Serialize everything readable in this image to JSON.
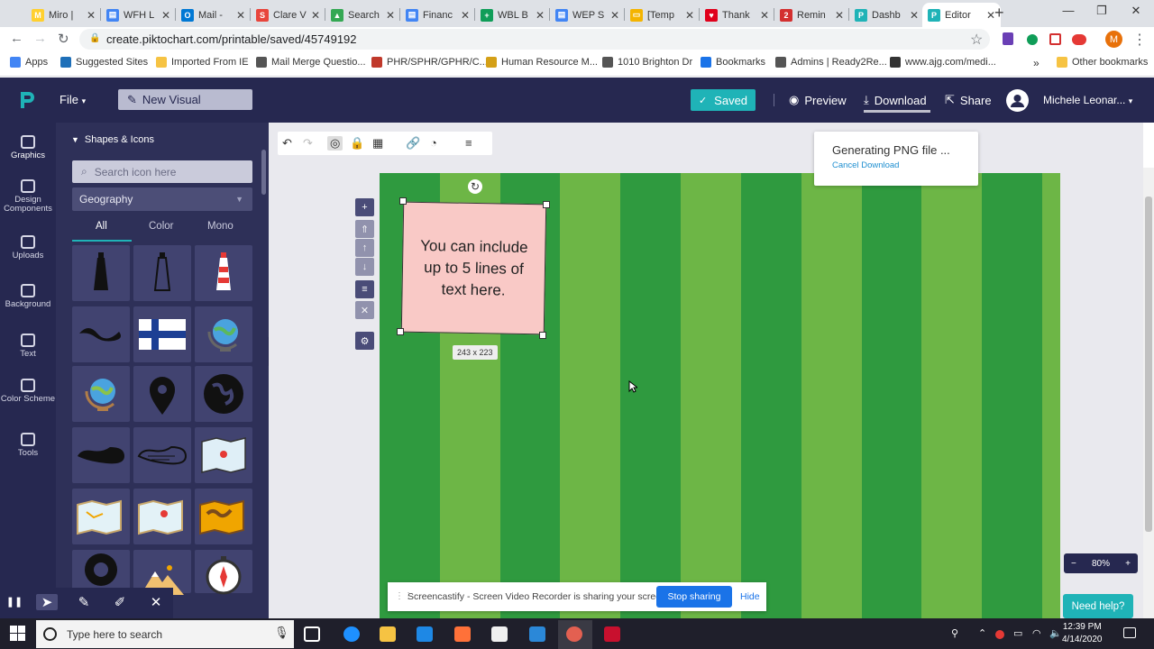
{
  "browser": {
    "tabs": [
      {
        "label": "Miro |",
        "color": "#ffd02f",
        "glyph": "M"
      },
      {
        "label": "WFH L",
        "color": "#4285f4",
        "glyph": "▤"
      },
      {
        "label": "Mail -",
        "color": "#0078d4",
        "glyph": "O"
      },
      {
        "label": "Clare V",
        "color": "#e8453c",
        "glyph": "S"
      },
      {
        "label": "Search",
        "color": "#34a853",
        "glyph": "▲"
      },
      {
        "label": "Financ",
        "color": "#4285f4",
        "glyph": "▤"
      },
      {
        "label": "WBL B",
        "color": "#0f9d58",
        "glyph": "+"
      },
      {
        "label": "WEP S",
        "color": "#4285f4",
        "glyph": "▤"
      },
      {
        "label": "[Temp",
        "color": "#f4b400",
        "glyph": "▭"
      },
      {
        "label": "Thank",
        "color": "#e0001b",
        "glyph": "♥"
      },
      {
        "label": "Remin",
        "color": "#d32f2f",
        "glyph": "2"
      },
      {
        "label": "Dashb",
        "color": "#1fb3b7",
        "glyph": "P"
      },
      {
        "label": "Editor",
        "color": "#1fb3b7",
        "glyph": "P"
      }
    ],
    "active_tab": "Editor",
    "new_tab_icon": "+",
    "window_controls": [
      "—",
      "❐",
      "✕"
    ],
    "url": "create.piktochart.com/printable/saved/45749192",
    "nav": {
      "back": "←",
      "forward": "→",
      "reload": "↻",
      "lock": "🔒",
      "star": "☆",
      "menu": "⋮",
      "profile": "M"
    },
    "bookmarks": [
      {
        "label": "Apps",
        "color": "#4285f4"
      },
      {
        "label": "Suggested Sites",
        "color": "#1e6fb8"
      },
      {
        "label": "Imported From IE",
        "color": "#f6c343"
      },
      {
        "label": "Mail Merge Questio...",
        "color": "#555"
      },
      {
        "label": "PHR/SPHR/GPHR/C...",
        "color": "#c0392b"
      },
      {
        "label": "Human Resource M...",
        "color": "#d4a017"
      },
      {
        "label": "1010 Brighton Dr",
        "color": "#555"
      },
      {
        "label": "Bookmarks",
        "color": "#1a73e8"
      },
      {
        "label": "Admins | Ready2Re...",
        "color": "#555"
      },
      {
        "label": "www.ajg.com/medi...",
        "color": "#333"
      }
    ],
    "more_bookmarks": "»",
    "other_bookmarks": "Other bookmarks"
  },
  "app": {
    "file_menu": "File",
    "new_visual": "New Visual",
    "saved": "Saved",
    "preview": "Preview",
    "download": "Download",
    "share": "Share",
    "user_name": "Michele Leonar...",
    "brand_color": "#1fb3b7",
    "header_color": "#262850"
  },
  "rail": [
    {
      "label": "Graphics",
      "active": true
    },
    {
      "label": "Design Components"
    },
    {
      "label": "Uploads"
    },
    {
      "label": "Background"
    },
    {
      "label": "Text"
    },
    {
      "label": "Color Scheme"
    },
    {
      "label": "Tools"
    }
  ],
  "panel": {
    "title": "Shapes & Icons",
    "search_placeholder": "Search icon here",
    "category": "Geography",
    "filters": [
      "All",
      "Color",
      "Mono"
    ],
    "active_filter": "All",
    "icons": [
      "lighthouse-icon",
      "lighthouse-outline-icon",
      "lighthouse-color-icon",
      "islands-icon",
      "finland-flag-icon",
      "globe-stand-icon",
      "globe-color-icon",
      "location-pin-icon",
      "earth-icon",
      "lake-black-icon",
      "lake-outline-icon",
      "map-color-icon",
      "map-fold-icon",
      "map-pin-icon",
      "treasure-map-icon",
      "lifebuoy-icon",
      "mountain-icon",
      "compass-icon"
    ]
  },
  "editor": {
    "toolbar": [
      "undo",
      "redo",
      "mask",
      "lock",
      "transparency",
      "link",
      "fill",
      "align"
    ],
    "toolbar_glyphs": [
      "↶",
      "↷",
      "◎",
      "🔒",
      "▦",
      "🔗",
      "◔",
      "≡"
    ],
    "vertical_tools": [
      "+",
      "⇑",
      "↑",
      "↓",
      "≡",
      "✕",
      "⚙"
    ],
    "note_text": "You can include up to 5 lines of text here.",
    "size_label": "243 x 223",
    "canvas_stripe_dark": "#2f9a3f",
    "canvas_stripe_light": "#6db646",
    "toast_title": "Generating PNG file ...",
    "toast_link": "Cancel Download",
    "zoom": "80%",
    "zoom_minus": "−",
    "zoom_plus": "+",
    "help": "Need help?"
  },
  "screencastify": {
    "message": "Screencastify - Screen Video Recorder is sharing your screen.",
    "stop": "Stop sharing",
    "hide": "Hide",
    "tools": [
      "❚❚",
      "➤",
      "✎",
      "✐",
      "✕"
    ]
  },
  "taskbar": {
    "search_placeholder": "Type here to search",
    "time": "12:39 PM",
    "date": "4/14/2020",
    "apps": [
      {
        "name": "task-view-icon",
        "color": "#ffffff"
      },
      {
        "name": "edge-icon",
        "color": "#1e90ff"
      },
      {
        "name": "file-explorer-icon",
        "color": "#f6c343"
      },
      {
        "name": "lync-icon",
        "color": "#1e88e5"
      },
      {
        "name": "firefox-icon",
        "color": "#ff7139"
      },
      {
        "name": "store-icon",
        "color": "#f0f0f0"
      },
      {
        "name": "mail-icon",
        "color": "#2b88d8"
      },
      {
        "name": "chrome-icon",
        "color": "#e04b3a"
      },
      {
        "name": "mcafee-icon",
        "color": "#c8102e"
      }
    ]
  }
}
